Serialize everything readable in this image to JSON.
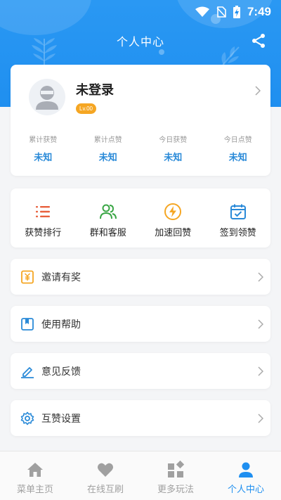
{
  "status_bar": {
    "time": "7:49"
  },
  "header": {
    "title": "个人中心",
    "share_icon": "share-icon"
  },
  "profile": {
    "name": "未登录",
    "level": "Lv.00",
    "stats": [
      {
        "label": "累计获赞",
        "value": "未知"
      },
      {
        "label": "累计点赞",
        "value": "未知"
      },
      {
        "label": "今日获赞",
        "value": "未知"
      },
      {
        "label": "今日点赞",
        "value": "未知"
      }
    ]
  },
  "actions": [
    {
      "label": "获赞排行",
      "icon": "ranking-list-icon",
      "color": "#e8603c"
    },
    {
      "label": "群和客服",
      "icon": "users-group-icon",
      "color": "#3aa645"
    },
    {
      "label": "加速回赞",
      "icon": "lightning-icon",
      "color": "#f5a623"
    },
    {
      "label": "签到领赞",
      "icon": "calendar-check-icon",
      "color": "#2a8ad8"
    }
  ],
  "menu": [
    {
      "label": "邀请有奖",
      "icon": "invite-reward-icon",
      "color": "#f5a623"
    },
    {
      "label": "使用帮助",
      "icon": "help-book-icon",
      "color": "#2a8ad8"
    },
    {
      "label": "意见反馈",
      "icon": "feedback-pen-icon",
      "color": "#2a8ad8"
    },
    {
      "label": "互赞设置",
      "icon": "settings-gear-icon",
      "color": "#2a8ad8"
    }
  ],
  "tabs": [
    {
      "label": "菜单主页",
      "icon": "home-icon",
      "active": false
    },
    {
      "label": "在线互刷",
      "icon": "heart-icon",
      "active": false
    },
    {
      "label": "更多玩法",
      "icon": "widgets-icon",
      "active": false
    },
    {
      "label": "个人中心",
      "icon": "person-icon",
      "active": true
    }
  ],
  "colors": {
    "primary": "#1f8ff0",
    "badge": "#f5a623",
    "inactive": "#a0a0a0"
  }
}
